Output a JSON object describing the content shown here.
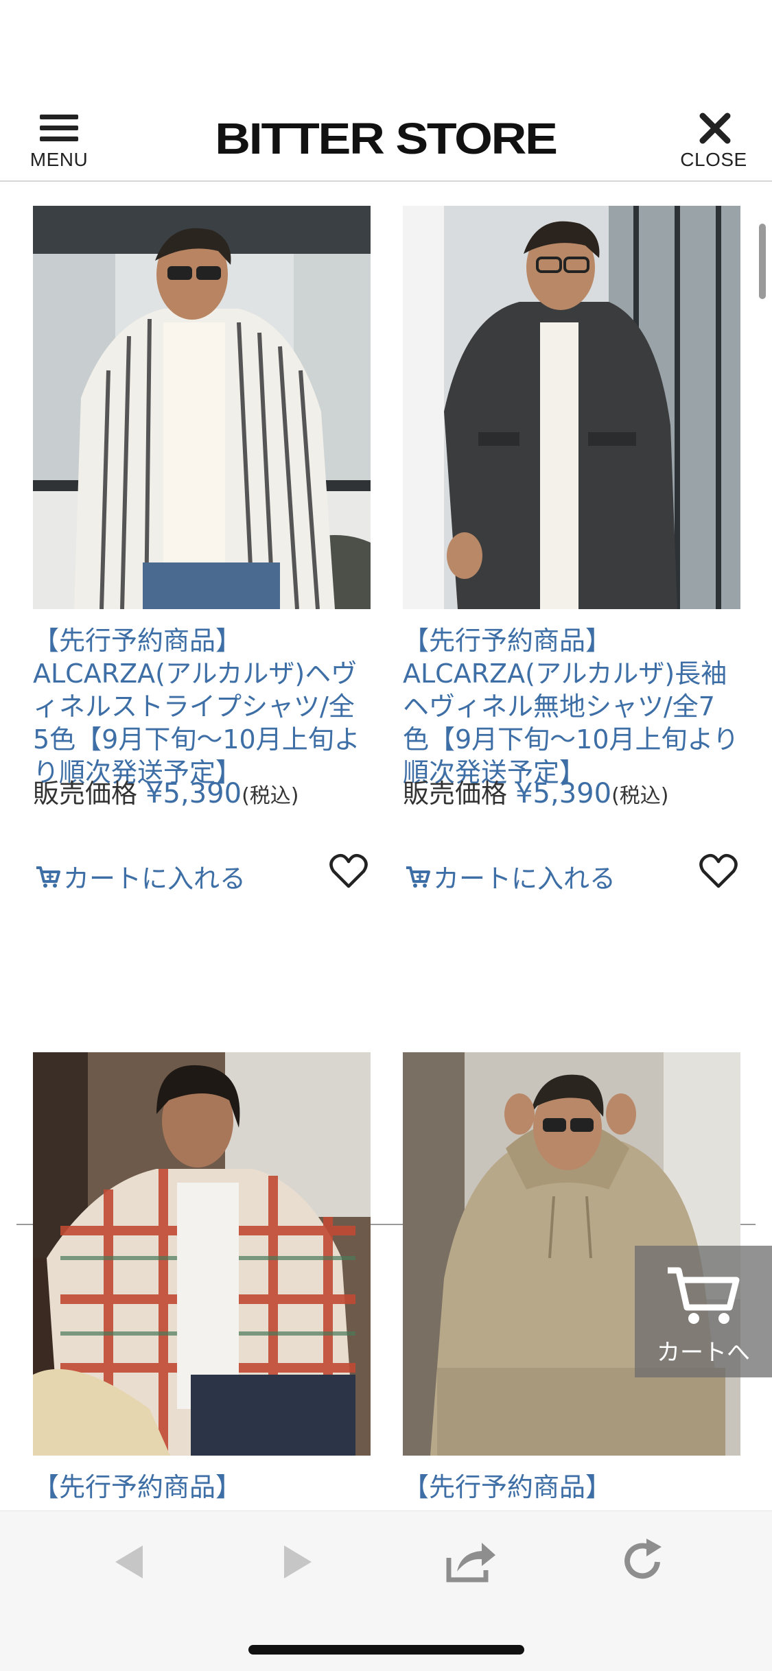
{
  "header": {
    "menu_label": "MENU",
    "logo": "BITTER STORE",
    "close_label": "CLOSE"
  },
  "products": [
    {
      "title": "【先行予約商品】ALCARZA(アルカルザ)ヘヴィネルストライプシャツ/全5色【9月下旬〜10月上旬より順次発送予定】",
      "price_label": "販売価格",
      "price": "¥5,390",
      "tax": "(税込)",
      "cart_label": "カートに入れる"
    },
    {
      "title": "【先行予約商品】ALCARZA(アルカルザ)長袖ヘヴィネル無地シャツ/全7色【9月下旬〜10月上旬より順次発送予定】",
      "price_label": "販売価格",
      "price": "¥5,390",
      "tax": "(税込)",
      "cart_label": "カートに入れる"
    },
    {
      "title": "【先行予約商品】"
    },
    {
      "title": "【先行予約商品】"
    }
  ],
  "float_cart": {
    "label": "カートへ"
  },
  "colors": {
    "accent": "#3d6ea5",
    "text": "#333333",
    "divider": "#9a9a9a"
  }
}
